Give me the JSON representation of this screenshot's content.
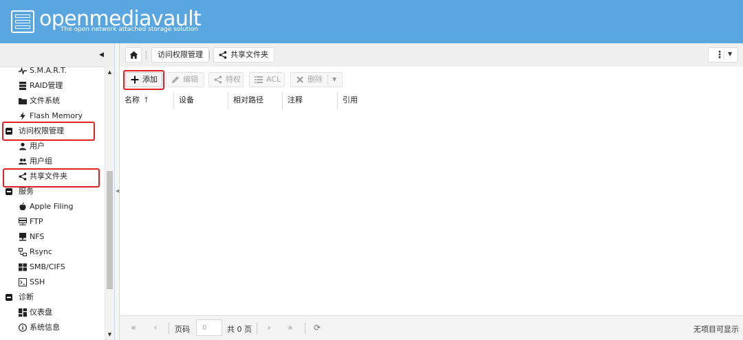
{
  "header": {
    "title": "openmediavault",
    "subtitle": "The open network attached storage solution"
  },
  "tree": {
    "items": [
      {
        "label": "S.M.A.R.T.",
        "icon": "heartbeat-icon",
        "type": "child"
      },
      {
        "label": "RAID管理",
        "icon": "raid-icon",
        "type": "child"
      },
      {
        "label": "文件系统",
        "icon": "folder-icon",
        "type": "child"
      },
      {
        "label": "Flash Memory",
        "icon": "flash-icon",
        "type": "child"
      },
      {
        "label": "访问权限管理",
        "icon": "collapse-icon",
        "type": "category"
      },
      {
        "label": "用户",
        "icon": "user-icon",
        "type": "child"
      },
      {
        "label": "用户组",
        "icon": "users-icon",
        "type": "child"
      },
      {
        "label": "共享文件夹",
        "icon": "share-icon",
        "type": "child"
      },
      {
        "label": "服务",
        "icon": "collapse-icon",
        "type": "category"
      },
      {
        "label": "Apple Filing",
        "icon": "apple-icon",
        "type": "child"
      },
      {
        "label": "FTP",
        "icon": "server-icon",
        "type": "child"
      },
      {
        "label": "NFS",
        "icon": "monitor-icon",
        "type": "child"
      },
      {
        "label": "Rsync",
        "icon": "rsync-icon",
        "type": "child"
      },
      {
        "label": "SMB/CIFS",
        "icon": "windows-icon",
        "type": "child"
      },
      {
        "label": "SSH",
        "icon": "terminal-icon",
        "type": "child"
      },
      {
        "label": "诊断",
        "icon": "collapse-icon",
        "type": "category"
      },
      {
        "label": "仪表盘",
        "icon": "dashboard-icon",
        "type": "child"
      },
      {
        "label": "系统信息",
        "icon": "info-icon",
        "type": "child"
      }
    ]
  },
  "breadcrumb": {
    "items": [
      "访问权限管理",
      "共享文件夹"
    ]
  },
  "toolbar": {
    "add": "添加",
    "edit": "编辑",
    "privileges": "特权",
    "acl": "ACL",
    "delete": "删除"
  },
  "grid": {
    "columns": [
      "名称",
      "设备",
      "相对路径",
      "注释",
      "引用"
    ]
  },
  "pager": {
    "page_label": "页码",
    "page_value": "0",
    "total": "共 0 页",
    "status": "无项目可显示"
  },
  "colors": {
    "header_bg": "#5aa6e0",
    "highlight": "#e02020"
  }
}
